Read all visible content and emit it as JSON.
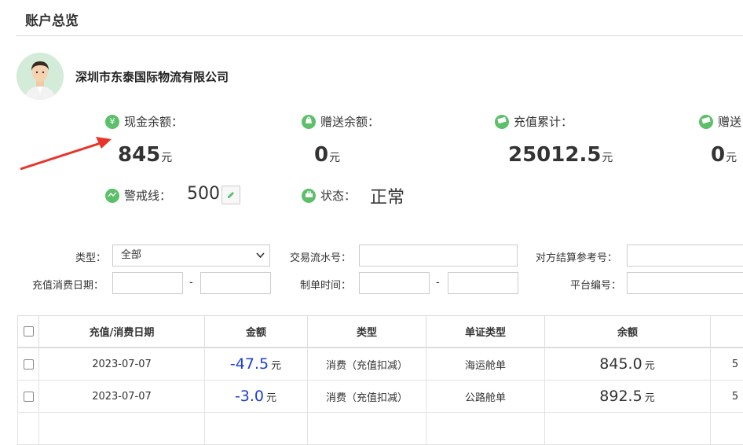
{
  "header": {
    "title": "账户总览"
  },
  "company": {
    "name": "深圳市东泰国际物流有限公司"
  },
  "stats": {
    "cash_balance": {
      "label": "现金余额：",
      "value": "845",
      "unit": "元",
      "icon": "yen-icon"
    },
    "gift_balance": {
      "label": "赠送余额：",
      "value": "0",
      "unit": "元",
      "icon": "bag-icon"
    },
    "recharge_total": {
      "label": "充值累计：",
      "value": "25012.5",
      "unit": "元",
      "icon": "money-icon"
    },
    "gift_total": {
      "label": "赠送",
      "value": "0",
      "unit": "元",
      "icon": "gift-card-icon"
    },
    "alert_line": {
      "label": "警戒线：",
      "value": "500",
      "icon": "wave-icon"
    },
    "status": {
      "label": "状态：",
      "value": "正常",
      "icon": "briefcase-icon"
    }
  },
  "filters": {
    "type_label": "类型：",
    "type_value": "全部",
    "serial_label": "交易流水号：",
    "counter_ref_label": "对方结算参考号：",
    "date_label": "充值消费日期：",
    "make_time_label": "制单时间：",
    "platform_label": "平台编号：",
    "range_dash": "-"
  },
  "table": {
    "headers": [
      "充值/消费日期",
      "金额",
      "类型",
      "单证类型",
      "余额"
    ],
    "rows": [
      {
        "date": "2023-07-07",
        "amount": "-47.5",
        "amount_unit": "元",
        "type": "消费（充值扣减）",
        "doc_type": "海运舱单",
        "balance": "845.0",
        "balance_unit": "元",
        "extra": "5"
      },
      {
        "date": "2023-07-07",
        "amount": "-3.0",
        "amount_unit": "元",
        "type": "消费（充值扣减）",
        "doc_type": "公路舱单",
        "balance": "892.5",
        "balance_unit": "元",
        "extra": "5"
      }
    ]
  },
  "colors": {
    "accent_green": "#5cbf6a",
    "amount_blue": "#1a3fd6",
    "arrow_red": "#e8342a"
  }
}
